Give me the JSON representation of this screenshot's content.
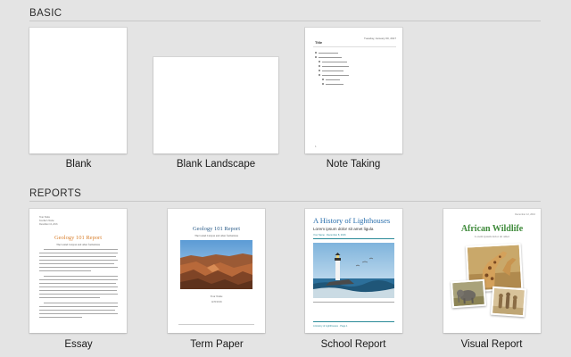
{
  "sections": {
    "basic": {
      "title": "BASIC"
    },
    "reports": {
      "title": "REPORTS"
    }
  },
  "templates": {
    "blank": {
      "label": "Blank"
    },
    "blank_landscape": {
      "label": "Blank Landscape"
    },
    "note_taking": {
      "label": "Note Taking",
      "preview_title": "Title",
      "preview_date": "Tuesday, January 00, 2017",
      "preview_page": "1"
    },
    "essay": {
      "label": "Essay",
      "preview_title": "Geology 101 Report",
      "preview_subtitle": "The Grand Canyon and other formations",
      "preview_header": [
        "Your Name",
        "Teacher's Name",
        "December 16, 2016"
      ]
    },
    "term_paper": {
      "label": "Term Paper",
      "preview_title": "Geology 101 Report",
      "preview_subtitle": "The Grand Canyon and other formations",
      "preview_author": "Your Name",
      "preview_date": "12/8/2016"
    },
    "school_report": {
      "label": "School Report",
      "preview_title": "A History of Lighthouses",
      "preview_subtitle": "Lorem ipsum dolor sit amet ligula",
      "preview_meta": "Your Name · December 8, 2016",
      "preview_footer": "A History of Lighthouses · Page 1"
    },
    "visual_report": {
      "label": "Visual Report",
      "preview_title": "African Wildlife",
      "preview_subtitle": "Lorem ipsum dolor sit amet",
      "preview_date": "December 12, 2016"
    }
  },
  "colors": {
    "essay_accent": "#d9812f",
    "term_paper_accent": "#2c5d8a",
    "school_report_accent": "#2a6fad",
    "visual_report_accent": "#3e8a3a"
  }
}
